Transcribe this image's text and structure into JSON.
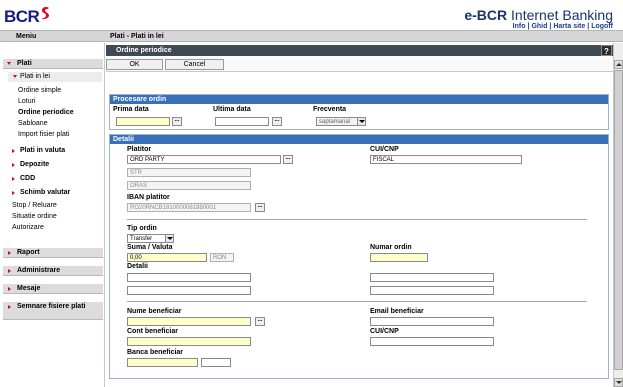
{
  "header": {
    "logo_text": "BCR",
    "brand_prefix": "e-BCR",
    "brand_suffix": " Internet Banking",
    "links": [
      "Info",
      "Ghid",
      "Harta site",
      "Logoff"
    ],
    "brand_color": "#1a3470",
    "logo_accent": "#e3001b"
  },
  "menubar": {
    "menu_label": "Meniu",
    "breadcrumb": "Plati - Plati in lei"
  },
  "sidebar": {
    "plati": "Plati",
    "plati_in_lei": "Plati in lei",
    "items": [
      "Ordine simple",
      "Loturi",
      "Ordine periodice",
      "Sabloane",
      "Import fisier plati"
    ],
    "groups": [
      "Plati in valuta",
      "Depozite",
      "CDD",
      "Schimb valutar"
    ],
    "extra": [
      "Stop / Reluare",
      "Situatie ordine",
      "Autorizare"
    ],
    "sections": [
      "Raport",
      "Administrare",
      "Mesaje",
      "Semnare fisiere plati"
    ]
  },
  "main": {
    "title": "Ordine periodice",
    "help": "?",
    "ok": "OK",
    "cancel": "Cancel",
    "procesare": {
      "title": "Procesare ordin",
      "prima_data": "Prima data",
      "ultima_data": "Ultima data",
      "frecventa": "Frecventa",
      "frecventa_value": "saptamanal",
      "dots": "..."
    },
    "detalii": {
      "title": "Detalii",
      "platitor": "Platitor",
      "platitor_name": "ORD PARTY",
      "platitor_str": "STR",
      "platitor_oras": "ORAS",
      "cui": "CUI/CNP",
      "cui_value": "FISCAL",
      "iban_platitor": "IBAN platitor",
      "iban_value": "RO20RNCB1810000081880001",
      "tip_ordin": "Tip ordin",
      "tip_ordin_value": "Transfer",
      "suma_valuta": "Suma / Valuta",
      "suma_value": "0,00",
      "valuta_value": "RON",
      "numar_ordin": "Numar ordin",
      "detalii_lbl": "Detalii",
      "nume_beneficiar": "Nume beneficiar",
      "email_beneficiar": "Email beneficiar",
      "cont_beneficiar": "Cont beneficiar",
      "cui_beneficiar": "CUI/CNP",
      "banca_beneficiar": "Banca beneficiar"
    }
  }
}
